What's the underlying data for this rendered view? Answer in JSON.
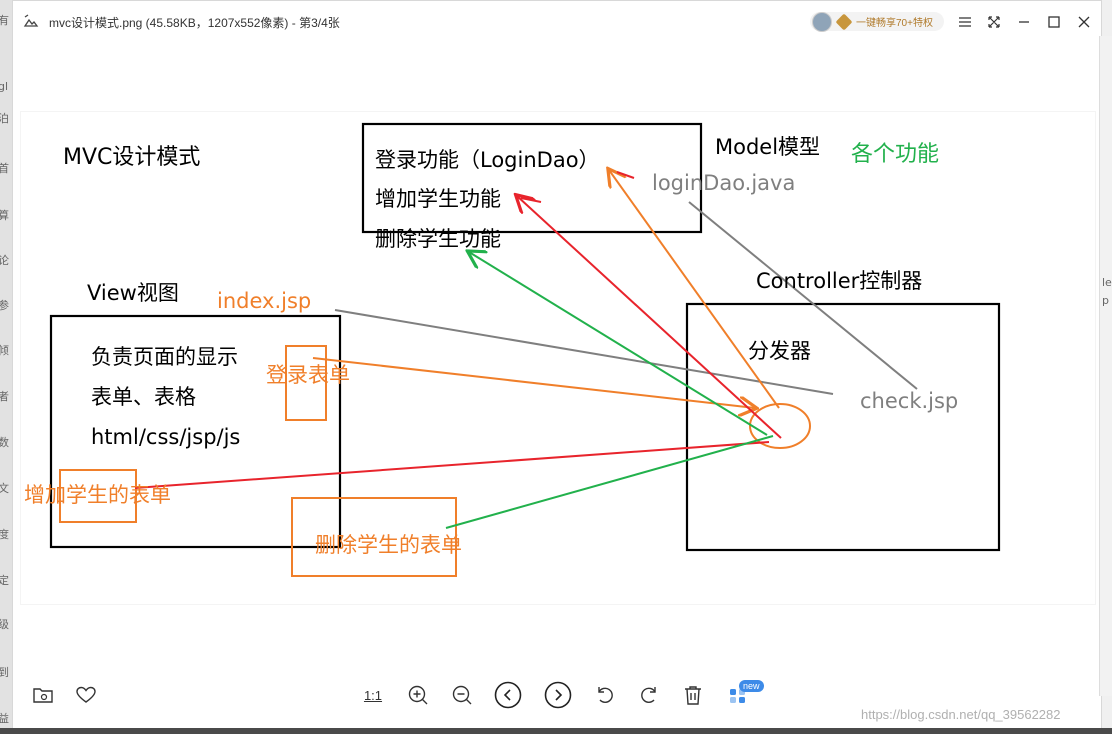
{
  "window": {
    "title": "mvc设计模式.png (45.58KB，1207x552像素) - 第3/4张",
    "share_label": "一键畅享70+特权"
  },
  "left_strip": [
    "有",
    "gl",
    "泊",
    "首",
    "算",
    "论",
    "参",
    "倾",
    "者",
    "数",
    "文",
    "度",
    "定",
    "级",
    "到",
    "益"
  ],
  "right_strip": [
    "le",
    "p"
  ],
  "diagram": {
    "texts": {
      "mvc_title": "MVC设计模式",
      "login_feature": "登录功能（LoginDao）",
      "add_feature": "增加学生功能",
      "delete_feature": "删除学生功能",
      "model_label": "Model模型",
      "features_label": "各个功能",
      "login_dao": "loginDao.java",
      "view_label": "View视图",
      "index_jsp": "index.jsp",
      "view_line1": "负责页面的显示",
      "view_line2": "表单、表格",
      "view_line3": "html/css/jsp/js",
      "login_form": "登录表单",
      "add_form": "增加学生的表单",
      "delete_form": "删除学生的表单",
      "controller_label": "Controller控制器",
      "dispatcher": "分发器",
      "check_jsp": "check.jsp"
    },
    "colors": {
      "black": "#000000",
      "orange": "#f07f2a",
      "red": "#e8242c",
      "green": "#22b14c",
      "gray": "#7f7f7f"
    }
  },
  "toolbar": {
    "actual_size": "1:1",
    "badge": "new",
    "icons": [
      "folder-icon",
      "heart-icon",
      "actual-size-icon",
      "zoom-in-icon",
      "zoom-out-icon",
      "previous-icon",
      "next-icon",
      "rotate-left-icon",
      "rotate-right-icon",
      "delete-icon",
      "apps-icon"
    ]
  },
  "watermark": "https://blog.csdn.net/qq_39562282"
}
